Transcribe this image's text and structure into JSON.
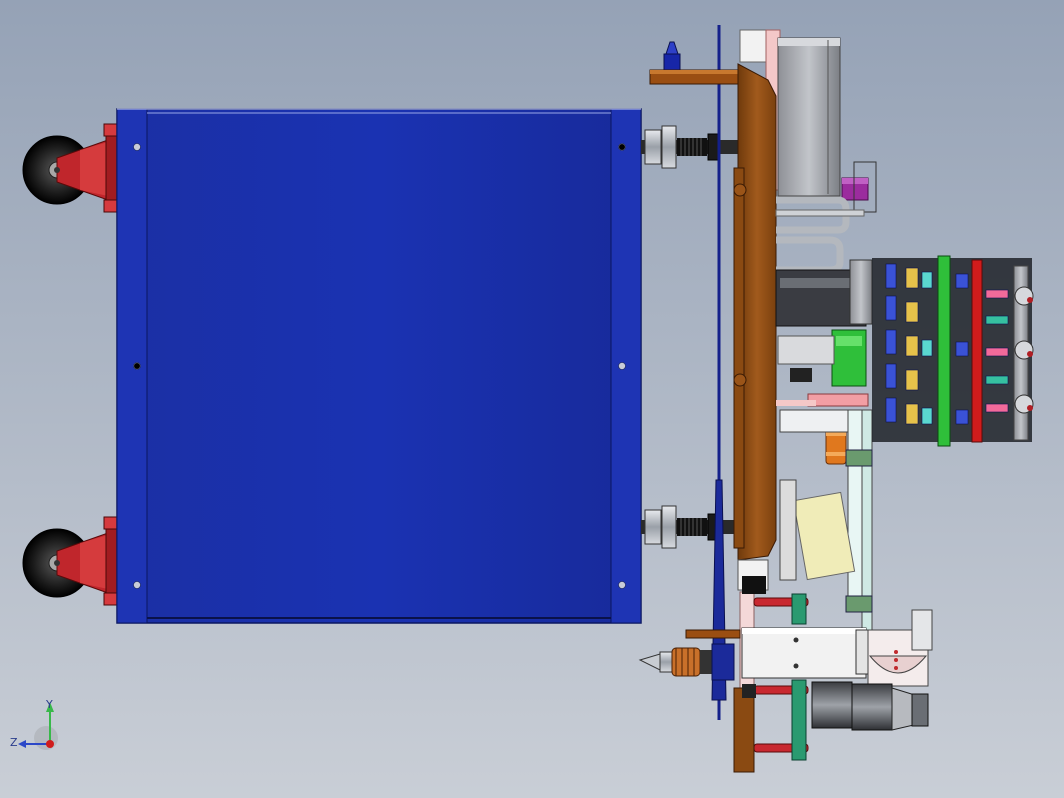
{
  "viewport": {
    "background_top": "#95a2b6",
    "background_bottom": "#c9ced6"
  },
  "triad": {
    "y_label": "Y",
    "z_label": "Z",
    "y_color": "#38b84a",
    "z_color": "#2c48c8",
    "x_color": "#d01c1c"
  },
  "colors": {
    "cabinet_blue": "#1a2ea8",
    "mount_plate": "#8a4a12",
    "caster_red": "#b61e24",
    "rod_red": "#c82830",
    "pcb_green": "#2fbf3a",
    "sensor_orange": "#e0781e",
    "purple_block": "#9b2c9e",
    "cyan_gasket": "#5ad8d0",
    "steel_grey": "#a9adb3"
  }
}
